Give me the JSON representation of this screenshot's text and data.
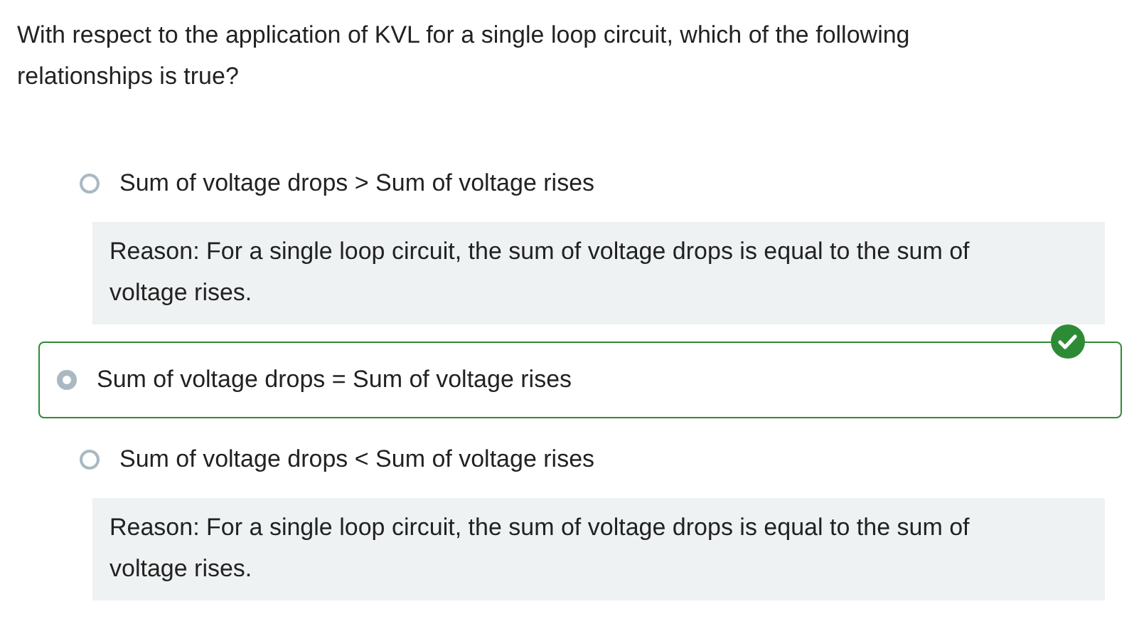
{
  "question": "With respect to the application of KVL for a single loop circuit, which of the following relationships is true?",
  "options": [
    {
      "label": "Sum of voltage drops > Sum of voltage rises",
      "selected": false,
      "correct": false,
      "reason": "Reason: For a single loop circuit, the sum of voltage drops is equal to the sum of voltage rises."
    },
    {
      "label": "Sum of voltage drops = Sum of voltage rises",
      "selected": true,
      "correct": true
    },
    {
      "label": "Sum of voltage drops < Sum of voltage rises",
      "selected": false,
      "correct": false,
      "reason": "Reason: For a single loop circuit, the sum of voltage drops is equal to the sum of voltage rises."
    }
  ]
}
